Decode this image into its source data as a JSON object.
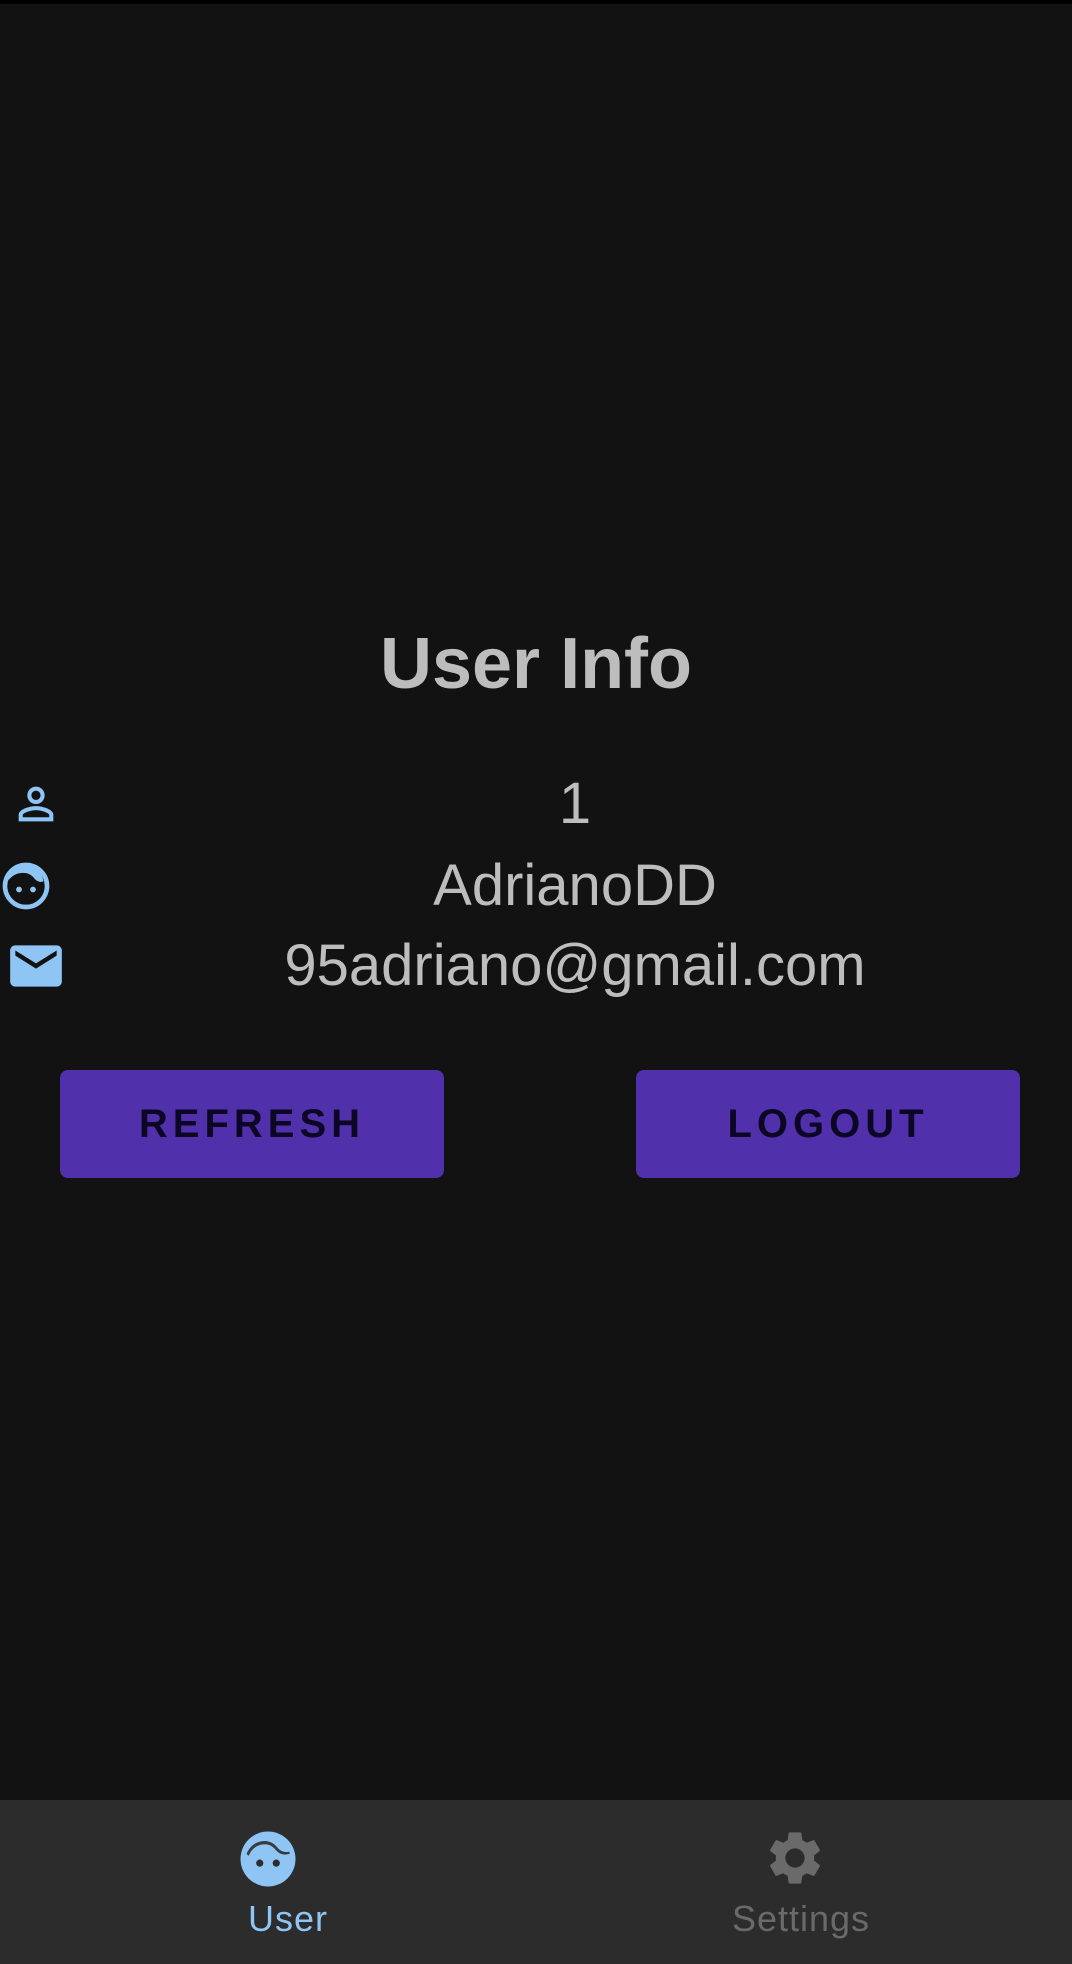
{
  "title": "User Info",
  "user": {
    "id": "1",
    "username": "AdrianoDD",
    "email": "95adriano@gmail.com"
  },
  "actions": {
    "refresh_label": "REFRESH",
    "logout_label": "LOGOUT"
  },
  "bottom_nav": {
    "items": [
      {
        "label": "User",
        "icon": "face-icon",
        "active": true
      },
      {
        "label": "Settings",
        "icon": "gear-icon",
        "active": false
      }
    ]
  },
  "colors": {
    "background": "#121212",
    "accent": "#8ec5f5",
    "button": "#5130ab",
    "nav_background": "#2c2c2c",
    "text": "#bdbdbd"
  }
}
